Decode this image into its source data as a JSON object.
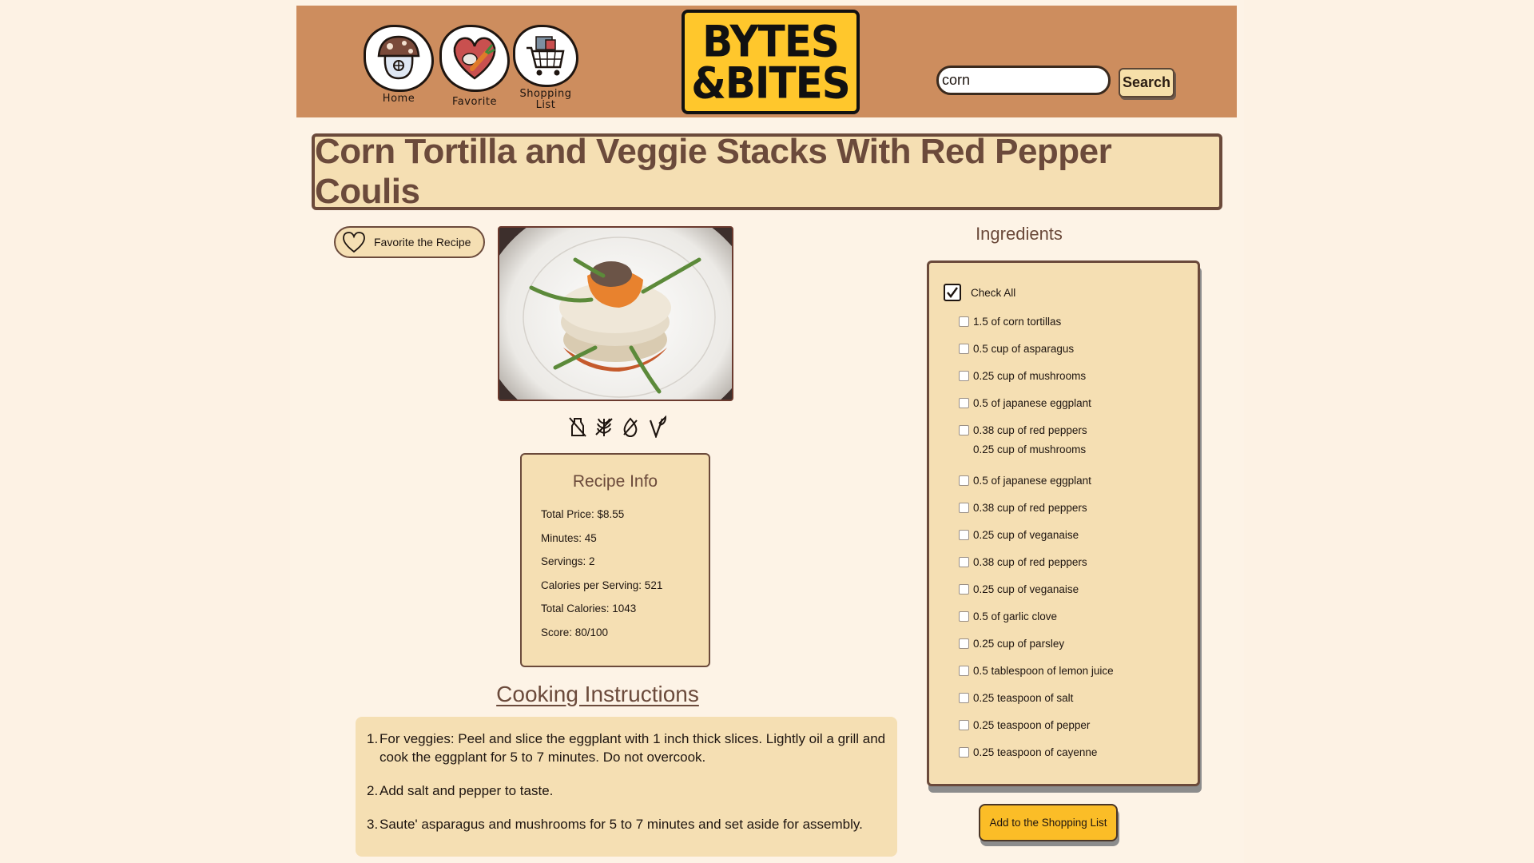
{
  "header": {
    "nav": [
      {
        "label": "Home",
        "icon": "mushroom-house-icon"
      },
      {
        "label": "Favorite",
        "icon": "heart-carrot-icon"
      },
      {
        "label": "Shopping List",
        "icon": "shopping-cart-icon"
      }
    ],
    "logo": {
      "line1": "BYTES",
      "line2": "&BITES"
    },
    "search": {
      "value": "corn",
      "button_label": "Search"
    }
  },
  "recipe": {
    "title": "Corn Tortilla and Veggie Stacks With Red Pepper Coulis",
    "favorite_label": "Favorite the Recipe",
    "diet_icons": [
      "dairy-free-icon",
      "gluten-free-icon",
      "no-fat-icon",
      "vegan-icon"
    ],
    "info": {
      "title": "Recipe Info",
      "lines": [
        "Total Price: $8.55",
        "Minutes: 45",
        "Servings: 2",
        "Calories per Serving: 521",
        "Total Calories: 1043",
        "Score: 80/100"
      ]
    },
    "instructions": {
      "title": "Cooking Instructions",
      "steps": [
        "For veggies: Peel and slice the eggplant with 1 inch thick slices. Lightly oil a grill and cook the eggplant for 5 to 7 minutes. Do not overcook.",
        "Add salt and pepper to taste.",
        "Saute' asparagus and mushrooms for 5 to 7 minutes and set aside for assembly."
      ]
    }
  },
  "ingredients": {
    "title": "Ingredients",
    "check_all_label": "Check All",
    "items": [
      "1.5 of corn tortillas",
      "0.5 cup of asparagus",
      "0.25 cup of mushrooms",
      "0.5 of japanese eggplant",
      "0.38 cup of red peppers",
      "0.25 cup of mushrooms",
      "0.5 of japanese eggplant",
      "0.38 cup of red peppers",
      "0.25 cup of veganaise",
      "0.38 cup of red peppers",
      "0.25 cup of veganaise",
      "0.5 of garlic clove",
      "0.25 cup of parsley",
      "0.5 tablespoon of lemon juice",
      "0.25 teaspoon of salt",
      "0.25 teaspoon of pepper",
      "0.25 teaspoon of cayenne"
    ],
    "add_button_label": "Add to the Shopping List"
  }
}
